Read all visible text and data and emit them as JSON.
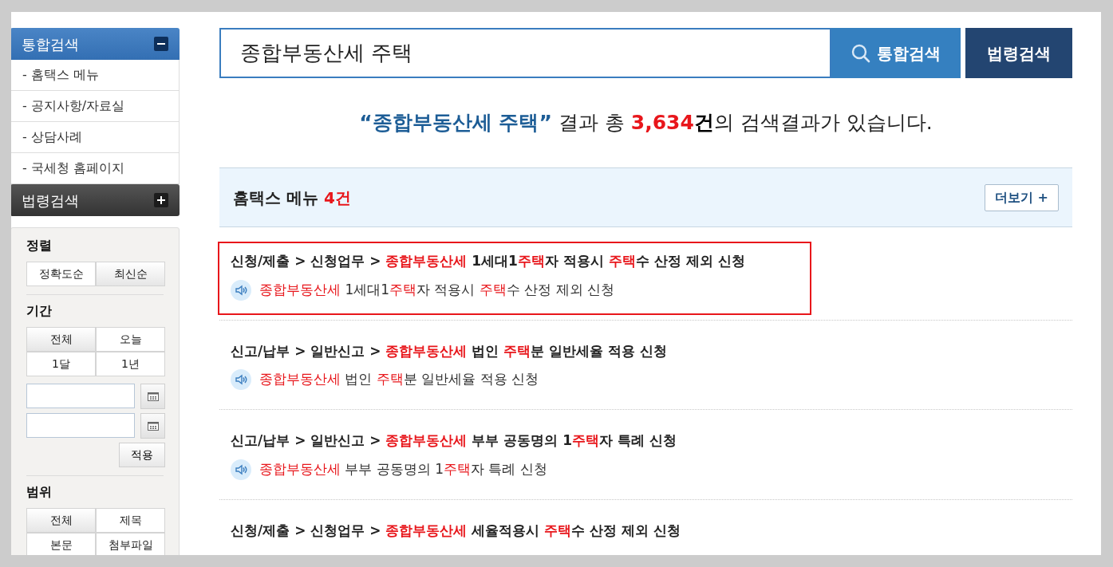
{
  "sidebar": {
    "sections": [
      {
        "title": "통합검색",
        "expanded": true,
        "items": [
          "- 홈택스 메뉴",
          "- 공지사항/자료실",
          "- 상담사례",
          "- 국세청 홈페이지"
        ]
      },
      {
        "title": "법령검색",
        "expanded": false
      }
    ],
    "filters": [
      {
        "kind": "buttons",
        "title": "정렬",
        "options": [
          {
            "label": "정확도순",
            "selected": false
          },
          {
            "label": "최신순",
            "selected": true
          }
        ]
      },
      {
        "kind": "period",
        "title": "기간",
        "options": [
          {
            "label": "전체",
            "selected": true
          },
          {
            "label": "오늘",
            "selected": false
          },
          {
            "label": "1달",
            "selected": false
          },
          {
            "label": "1년",
            "selected": false
          }
        ],
        "apply_button": "적용"
      },
      {
        "kind": "buttons",
        "title": "범위",
        "options": [
          {
            "label": "전체",
            "selected": true
          },
          {
            "label": "제목",
            "selected": false
          },
          {
            "label": "본문",
            "selected": false
          },
          {
            "label": "첨부파일",
            "selected": false
          }
        ]
      }
    ]
  },
  "search": {
    "value": "종합부동산세 주택",
    "search_button": "통합검색",
    "law_button": "법령검색"
  },
  "summary": {
    "quote_open": "“",
    "query": "종합부동산세 주택",
    "quote_close": "”",
    "middle": " 결과 총 ",
    "count": "3,634",
    "unit": "건",
    "end": "의 검색결과가 있습니다."
  },
  "section": {
    "title": "홈택스 메뉴",
    "count": "4건",
    "more_button": "더보기 +"
  },
  "results": [
    {
      "selected": true,
      "title": [
        {
          "text": "신청/제출 > 신청업무 > ",
          "highlight": false
        },
        {
          "text": "종합부동산세",
          "highlight": true
        },
        {
          "text": " 1세대1",
          "highlight": false
        },
        {
          "text": "주택",
          "highlight": true
        },
        {
          "text": "자 적용시 ",
          "highlight": false
        },
        {
          "text": "주택",
          "highlight": true
        },
        {
          "text": "수 산정 제외 신청",
          "highlight": false
        }
      ],
      "subtitle": [
        {
          "text": "종합부동산세",
          "highlight": true
        },
        {
          "text": " 1세대1",
          "highlight": false
        },
        {
          "text": "주택",
          "highlight": true
        },
        {
          "text": "자 적용시 ",
          "highlight": false
        },
        {
          "text": "주택",
          "highlight": true
        },
        {
          "text": "수 산정 제외 신청",
          "highlight": false
        }
      ]
    },
    {
      "selected": false,
      "title": [
        {
          "text": "신고/납부 > 일반신고 > ",
          "highlight": false
        },
        {
          "text": "종합부동산세",
          "highlight": true
        },
        {
          "text": " 법인 ",
          "highlight": false
        },
        {
          "text": "주택",
          "highlight": true
        },
        {
          "text": "분 일반세율 적용 신청",
          "highlight": false
        }
      ],
      "subtitle": [
        {
          "text": "종합부동산세",
          "highlight": true
        },
        {
          "text": " 법인 ",
          "highlight": false
        },
        {
          "text": "주택",
          "highlight": true
        },
        {
          "text": "분 일반세율 적용 신청",
          "highlight": false
        }
      ]
    },
    {
      "selected": false,
      "title": [
        {
          "text": "신고/납부 > 일반신고 > ",
          "highlight": false
        },
        {
          "text": "종합부동산세",
          "highlight": true
        },
        {
          "text": " 부부 공동명의 1",
          "highlight": false
        },
        {
          "text": "주택",
          "highlight": true
        },
        {
          "text": "자 특례 신청",
          "highlight": false
        }
      ],
      "subtitle": [
        {
          "text": "종합부동산세",
          "highlight": true
        },
        {
          "text": " 부부 공동명의 1",
          "highlight": false
        },
        {
          "text": "주택",
          "highlight": true
        },
        {
          "text": "자 특례 신청",
          "highlight": false
        }
      ]
    },
    {
      "selected": false,
      "title": [
        {
          "text": "신청/제출 > 신청업무 > ",
          "highlight": false
        },
        {
          "text": "종합부동산세",
          "highlight": true
        },
        {
          "text": " 세율적용시 ",
          "highlight": false
        },
        {
          "text": "주택",
          "highlight": true
        },
        {
          "text": "수 산정 제외 신청",
          "highlight": false
        }
      ]
    }
  ]
}
